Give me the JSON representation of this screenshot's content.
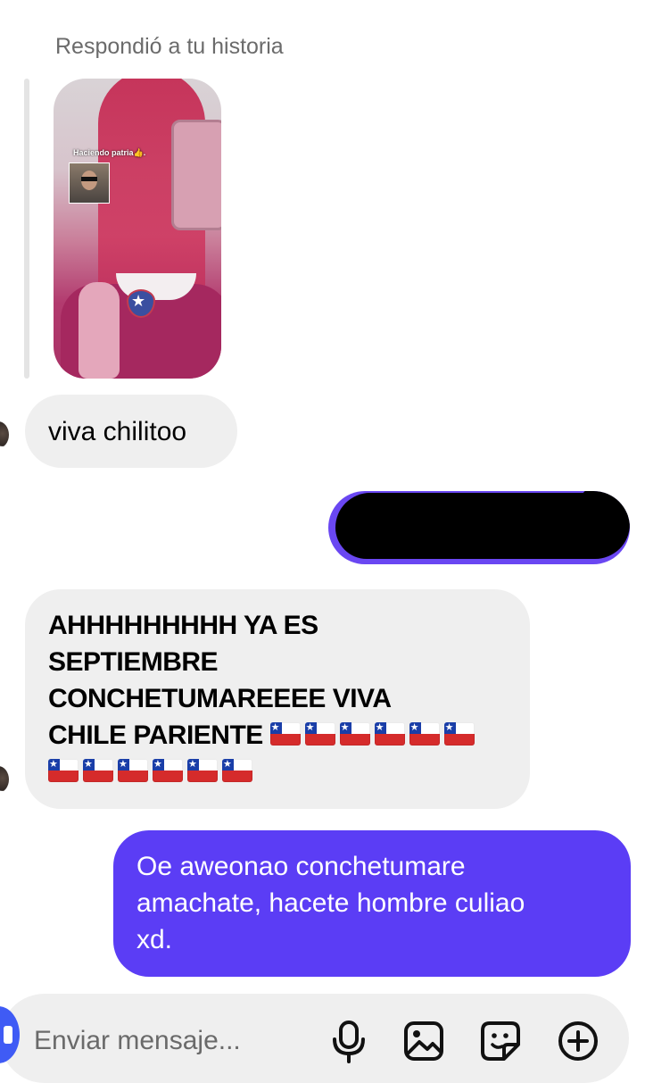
{
  "story_reply": {
    "label": "Respondió a tu historia",
    "story_caption": "Haciendo patria👍."
  },
  "messages": [
    {
      "direction": "incoming",
      "text": "viva chilitoo"
    },
    {
      "direction": "outgoing",
      "text": "",
      "redacted": true
    },
    {
      "direction": "incoming",
      "lines": [
        "AHHHHHHHHH YA ES",
        "SEPTIEMBRE",
        "CONCHETUMAREEEE VIVA",
        "CHILE PARIENTE"
      ],
      "flags_count": 12
    },
    {
      "direction": "outgoing",
      "lines": [
        "Oe aweonao conchetumare",
        "amachate, hacete hombre culiao",
        "xd."
      ]
    }
  ],
  "composer": {
    "placeholder": "Enviar mensaje...",
    "icons": [
      "microphone-icon",
      "image-icon",
      "sticker-icon",
      "plus-icon"
    ]
  },
  "colors": {
    "outgoing_bubble": "#5b3df5",
    "incoming_bubble": "#efefef",
    "camera_button": "#3f5bf5"
  }
}
